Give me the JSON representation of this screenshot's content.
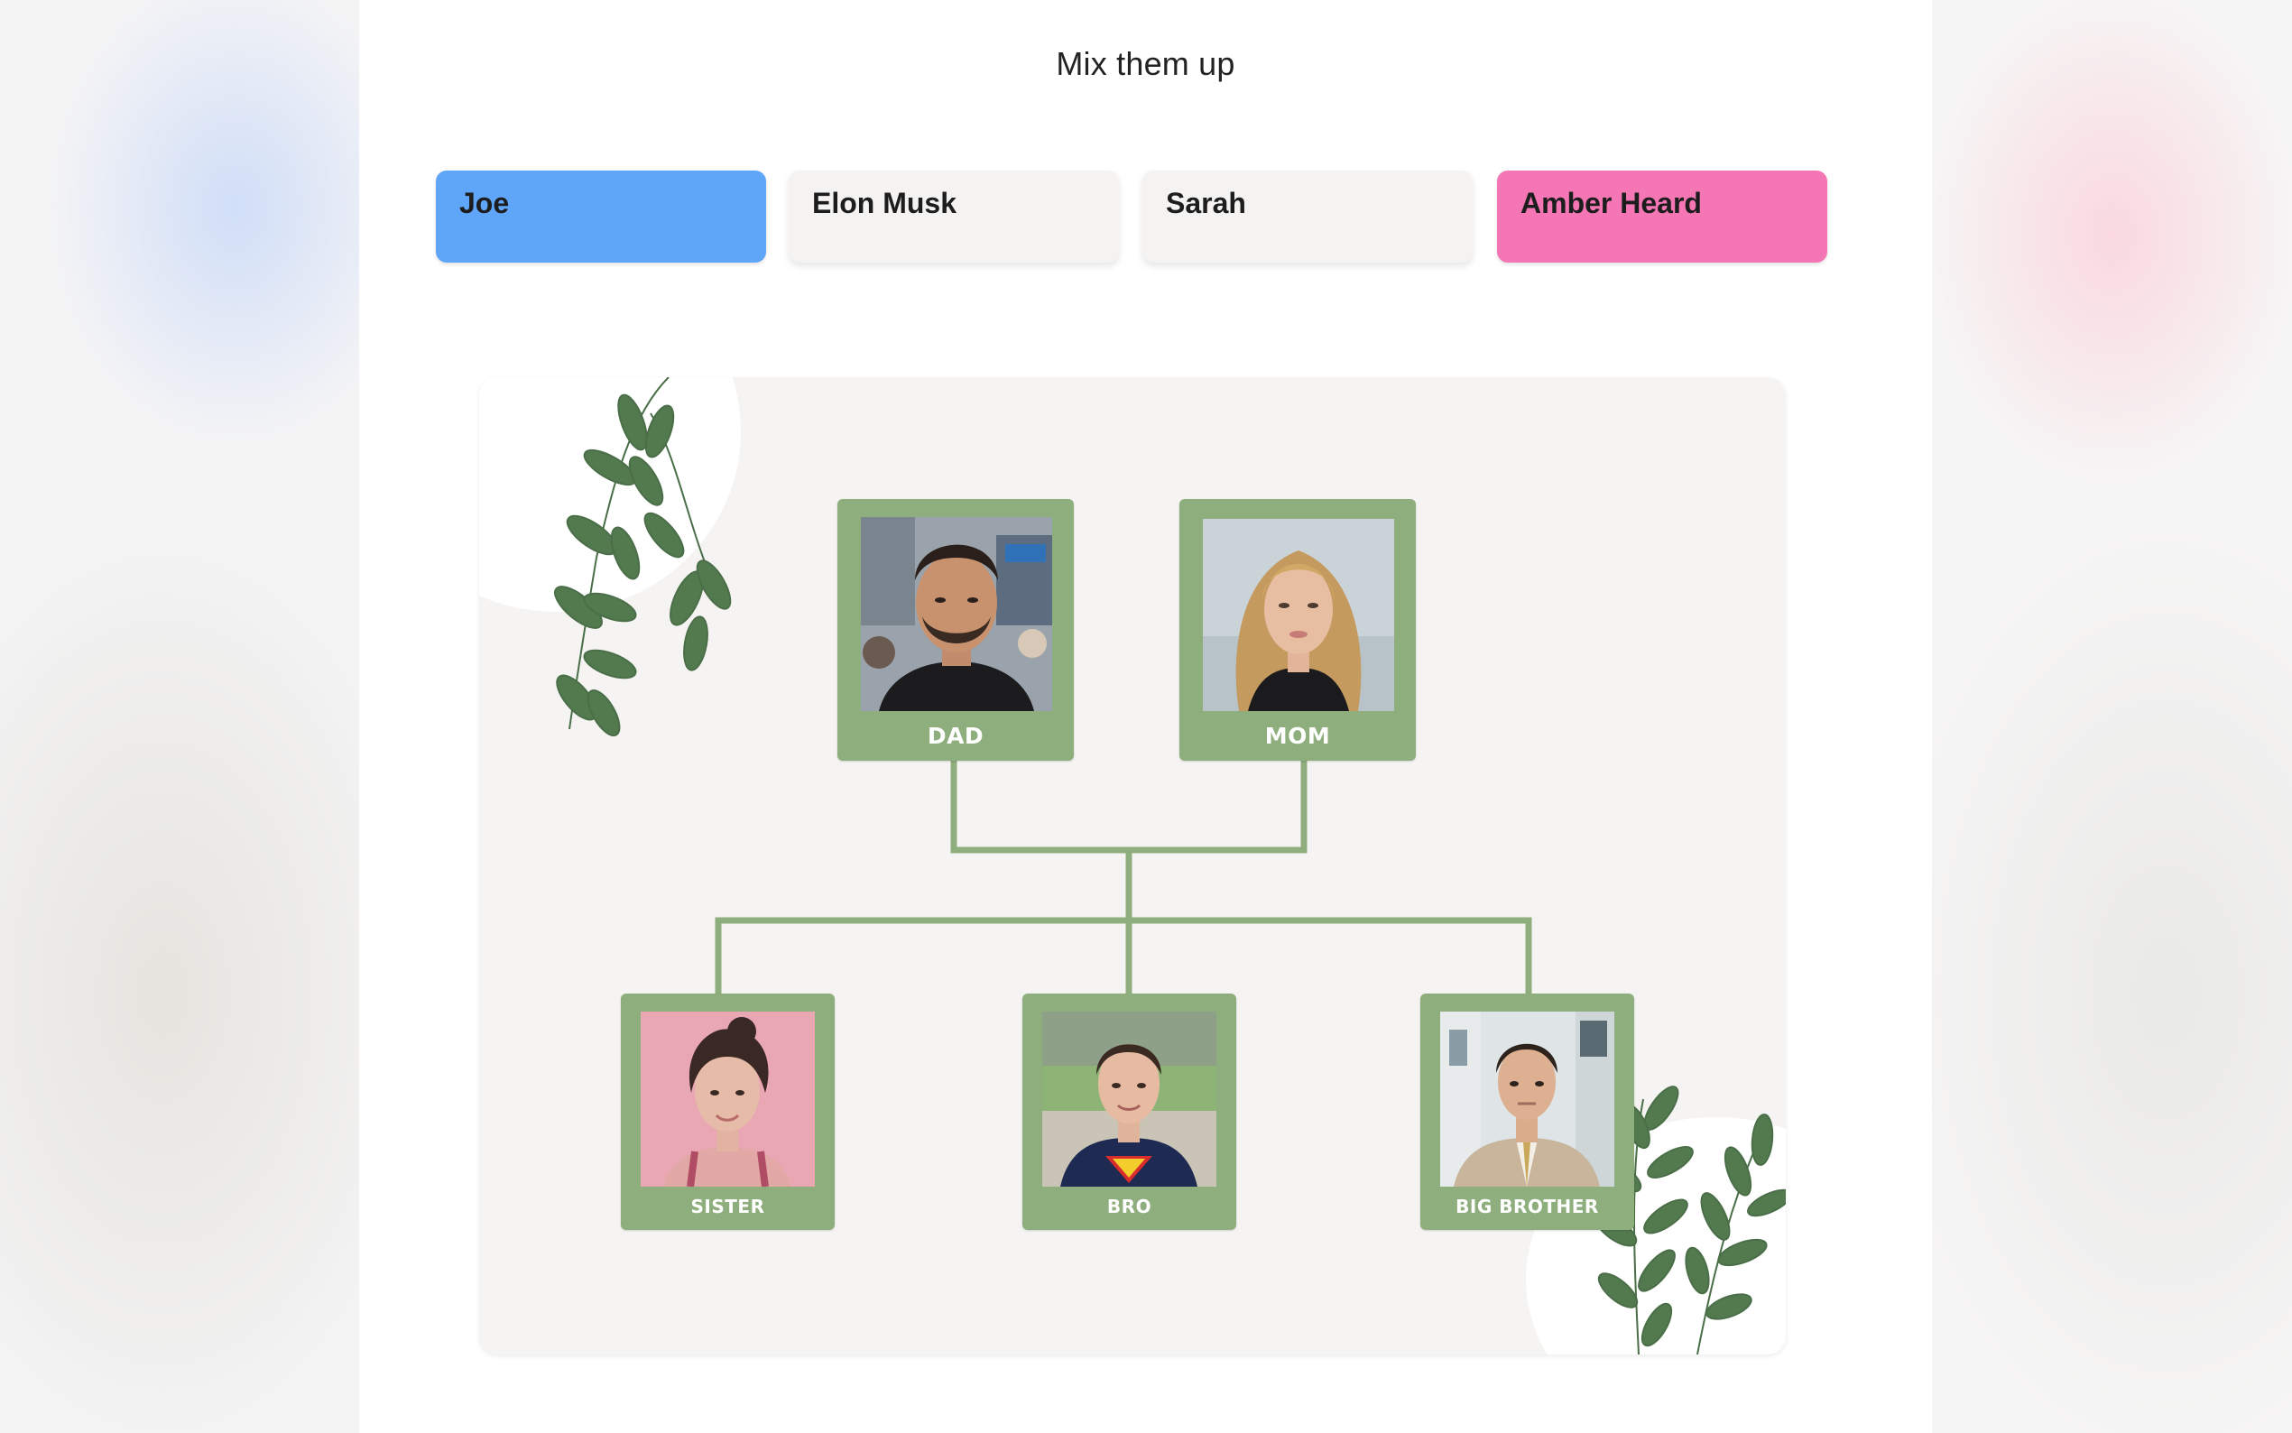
{
  "header": {
    "title": "Mix them up"
  },
  "names": [
    {
      "label": "Joe",
      "color": "#5fa5f8"
    },
    {
      "label": "Elon Musk",
      "color": "#f4f3f2"
    },
    {
      "label": "Sarah",
      "color": "#f4f3f2"
    },
    {
      "label": "Amber Heard",
      "color": "#f576b4"
    }
  ],
  "tree": {
    "dad": {
      "label": "DAD"
    },
    "mom": {
      "label": "MOM"
    },
    "sister": {
      "label": "SISTER"
    },
    "bro": {
      "label": "BRO"
    },
    "big_brother": {
      "label": "BIG BROTHER"
    }
  },
  "colors": {
    "frame": "#8fae7e",
    "line": "#8fae7e",
    "leaf": "#537a4f"
  }
}
